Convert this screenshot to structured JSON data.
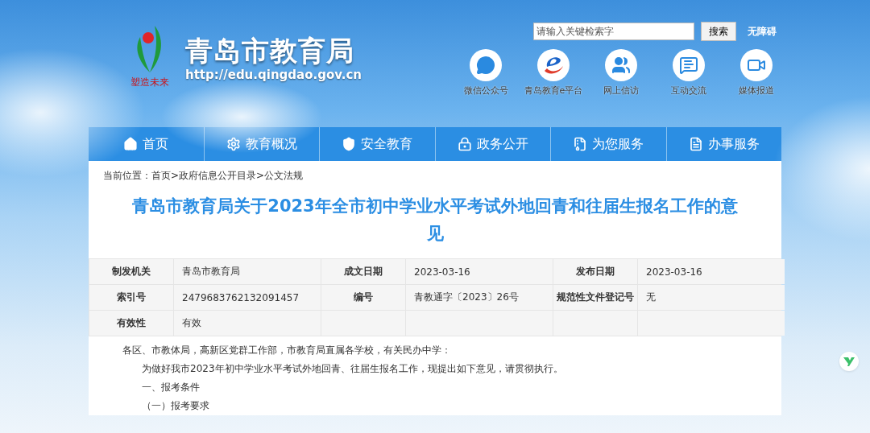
{
  "header": {
    "site_name": "青岛市教育局",
    "site_url": "http://edu.qingdao.gov.cn",
    "logo_motto": "塑造未来",
    "search": {
      "placeholder": "请输入关键检索字",
      "button": "搜索"
    },
    "accessibility_link": "无障碍",
    "quick_links": [
      {
        "kind": "wechat",
        "label": "微信公众号"
      },
      {
        "kind": "eplatform",
        "label": "青岛教育e平台"
      },
      {
        "kind": "visit",
        "label": "网上信访"
      },
      {
        "kind": "chat",
        "label": "互动交流"
      },
      {
        "kind": "media",
        "label": "媒体报道"
      }
    ]
  },
  "nav": [
    {
      "kind": "home",
      "label": "首页"
    },
    {
      "kind": "overview",
      "label": "教育概况"
    },
    {
      "kind": "safety",
      "label": "安全教育"
    },
    {
      "kind": "public",
      "label": "政务公开"
    },
    {
      "kind": "service",
      "label": "为您服务"
    },
    {
      "kind": "affairs",
      "label": "办事服务"
    }
  ],
  "breadcrumb": {
    "prefix": "当前位置：",
    "items": [
      "首页",
      "政府信息公开目录",
      "公文法规"
    ],
    "separator": ">"
  },
  "article": {
    "title": "青岛市教育局关于2023年全市初中学业水平考试外地回青和往届生报名工作的意见",
    "meta": [
      [
        {
          "label": "制发机关",
          "value": "青岛市教育局"
        },
        {
          "label": "成文日期",
          "value": "2023-03-16"
        },
        {
          "label": "发布日期",
          "value": "2023-03-16"
        }
      ],
      [
        {
          "label": "索引号",
          "value": "2479683762132091457"
        },
        {
          "label": "编号",
          "value": "青教通字〔2023〕26号"
        },
        {
          "label": "规范性文件登记号",
          "value": "无"
        }
      ],
      [
        {
          "label": "有效性",
          "value": "有效"
        }
      ]
    ],
    "paragraphs": [
      {
        "kind": "salutation",
        "text": "各区、市教体局，高新区党群工作部，市教育局直属各学校，有关民办中学："
      },
      {
        "kind": "body",
        "text": "为做好我市2023年初中学业水平考试外地回青、往届生报名工作，现提出如下意见，请贯彻执行。"
      },
      {
        "kind": "body",
        "text": "一、报考条件"
      },
      {
        "kind": "body",
        "text": "（一）报考要求"
      }
    ]
  }
}
